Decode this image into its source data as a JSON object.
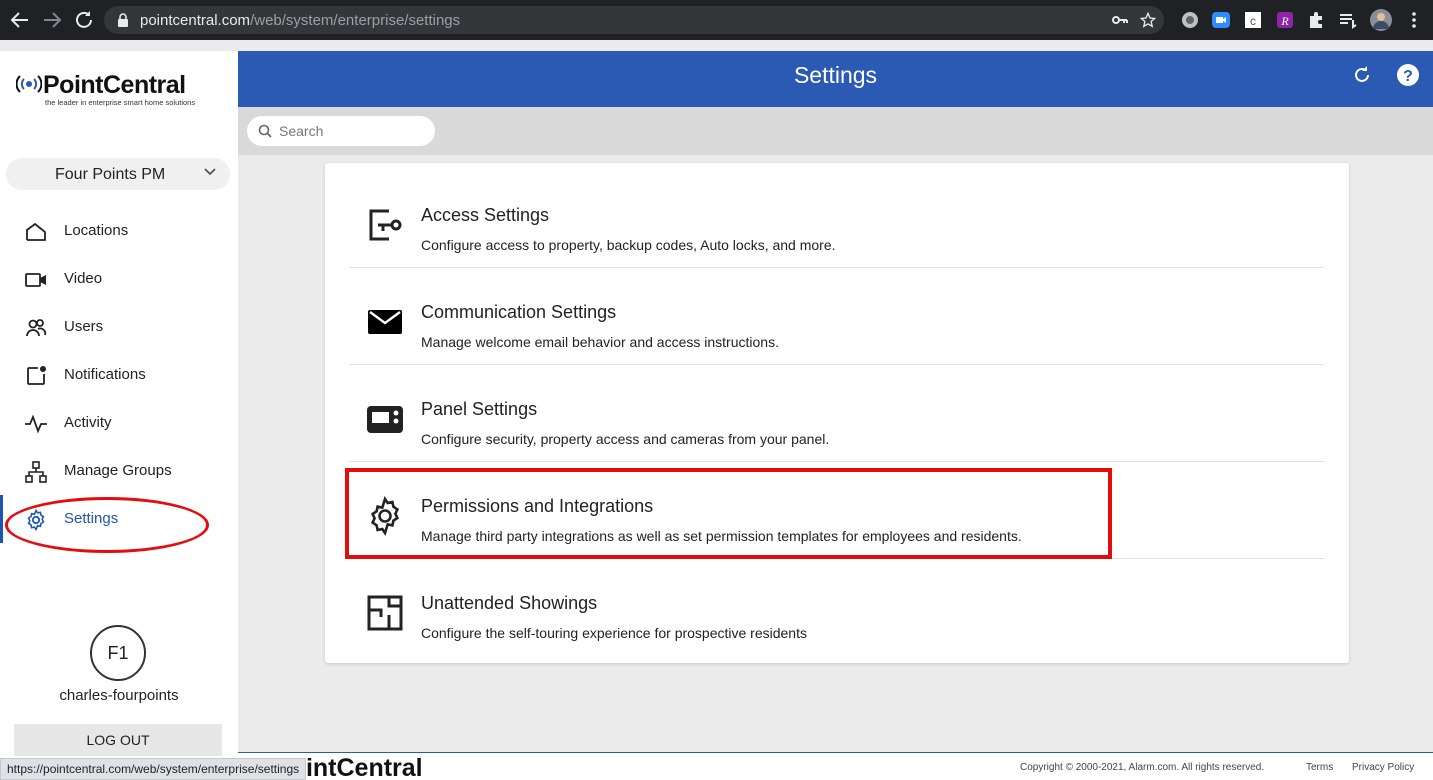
{
  "browser": {
    "url_domain": "pointcentral.com",
    "url_path": "/web/system/enterprise/settings",
    "status_url": "https://pointcentral.com/web/system/enterprise/settings"
  },
  "brand": {
    "name": "PointCentral",
    "tagline": "the leader in enterprise smart home solutions",
    "accent_color": "#2a5ab4"
  },
  "sidebar": {
    "org_selector": "Four Points PM",
    "items": [
      {
        "label": "Locations",
        "icon": "home-icon"
      },
      {
        "label": "Video",
        "icon": "video-camera-icon"
      },
      {
        "label": "Users",
        "icon": "users-icon"
      },
      {
        "label": "Notifications",
        "icon": "notification-icon"
      },
      {
        "label": "Activity",
        "icon": "activity-pulse-icon"
      },
      {
        "label": "Manage Groups",
        "icon": "hierarchy-icon"
      },
      {
        "label": "Settings",
        "icon": "gear-icon",
        "active": true
      }
    ],
    "avatar_initials": "F1",
    "username": "charles-fourpoints",
    "logout_label": "LOG OUT"
  },
  "header": {
    "title": "Settings"
  },
  "search": {
    "placeholder": "Search"
  },
  "settings": [
    {
      "title": "Access Settings",
      "description": "Configure access to property, backup codes, Auto locks, and more.",
      "icon": "key-access-icon"
    },
    {
      "title": "Communication Settings",
      "description": "Manage welcome email behavior and access instructions.",
      "icon": "envelope-icon"
    },
    {
      "title": "Panel Settings",
      "description": "Configure security, property access and cameras from your panel.",
      "icon": "panel-icon"
    },
    {
      "title": "Permissions and Integrations",
      "description": "Manage third party integrations as well as set permission templates for employees and residents.",
      "icon": "gear-icon"
    },
    {
      "title": "Unattended Showings",
      "description": "Configure the self-touring experience for prospective residents",
      "icon": "floorplan-icon"
    }
  ],
  "footer": {
    "logo_text": "PointCentral",
    "copyright": "Copyright © 2000-2021, Alarm.com. All rights reserved.",
    "terms": "Terms",
    "privacy": "Privacy Policy"
  }
}
